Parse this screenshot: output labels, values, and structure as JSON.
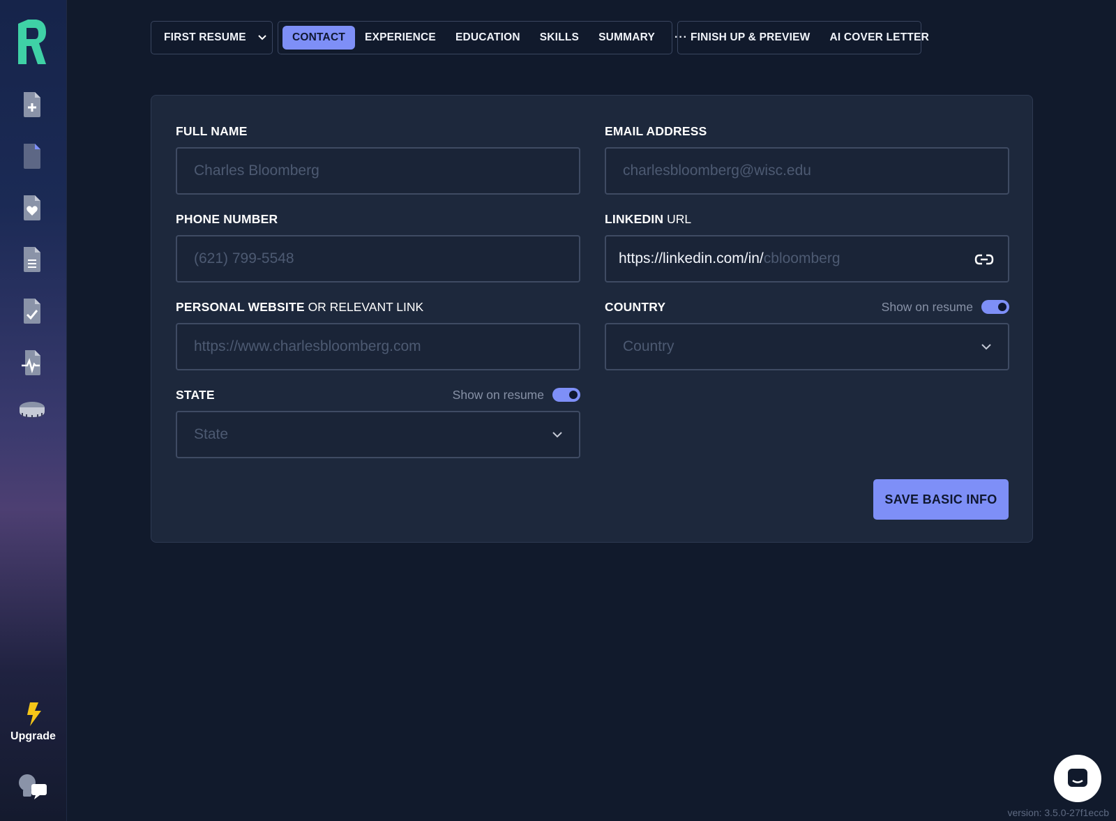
{
  "nav": {
    "resume_selector": "FIRST RESUME",
    "tabs": [
      "CONTACT",
      "EXPERIENCE",
      "EDUCATION",
      "SKILLS",
      "SUMMARY"
    ],
    "more": "···",
    "finish_items": [
      "FINISH UP & PREVIEW",
      "AI COVER LETTER"
    ]
  },
  "sidebar": {
    "upgrade_label": "Upgrade"
  },
  "form": {
    "full_name": {
      "label": "FULL NAME",
      "placeholder": "Charles Bloomberg"
    },
    "email": {
      "label": "EMAIL ADDRESS",
      "placeholder": "charlesbloomberg@wisc.edu"
    },
    "phone": {
      "label": "PHONE NUMBER",
      "placeholder": "(621) 799-5548"
    },
    "linkedin": {
      "label_bold": "LINKEDIN",
      "label_light": " URL",
      "prefix": "https://linkedin.com/in/",
      "placeholder": "cbloomberg"
    },
    "website": {
      "label_bold": "PERSONAL WEBSITE",
      "label_light": " OR RELEVANT LINK",
      "placeholder": "https://www.charlesbloomberg.com"
    },
    "country": {
      "label": "COUNTRY",
      "show_label": "Show on resume",
      "show_on_resume": true,
      "placeholder": "Country"
    },
    "state": {
      "label": "STATE",
      "show_label": "Show on resume",
      "show_on_resume": true,
      "placeholder": "State"
    },
    "save_label": "SAVE BASIC INFO"
  },
  "version": "version: 3.5.0-27f1eccb",
  "colors": {
    "accent": "#7e8ff7",
    "logo": "#3fd1a6",
    "background": "#111a2c",
    "card": "#1d283c"
  }
}
